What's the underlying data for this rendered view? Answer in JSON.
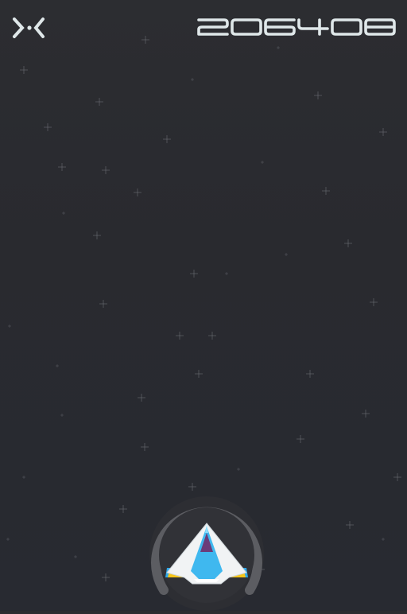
{
  "hud": {
    "close_icon": "close-x-icon",
    "score": "206408"
  },
  "player": {
    "ship_icon": "spaceship-icon",
    "shield_icon": "shield-ring-icon",
    "colors": {
      "hull": "#f1f3f4",
      "cockpit": "#3fb8ef",
      "engine": "#f5c51a",
      "ring": "#5c5d62"
    }
  },
  "colors": {
    "background": "#2a2b30",
    "hud_text": "#dfe7e9",
    "star": "#6f7178"
  }
}
